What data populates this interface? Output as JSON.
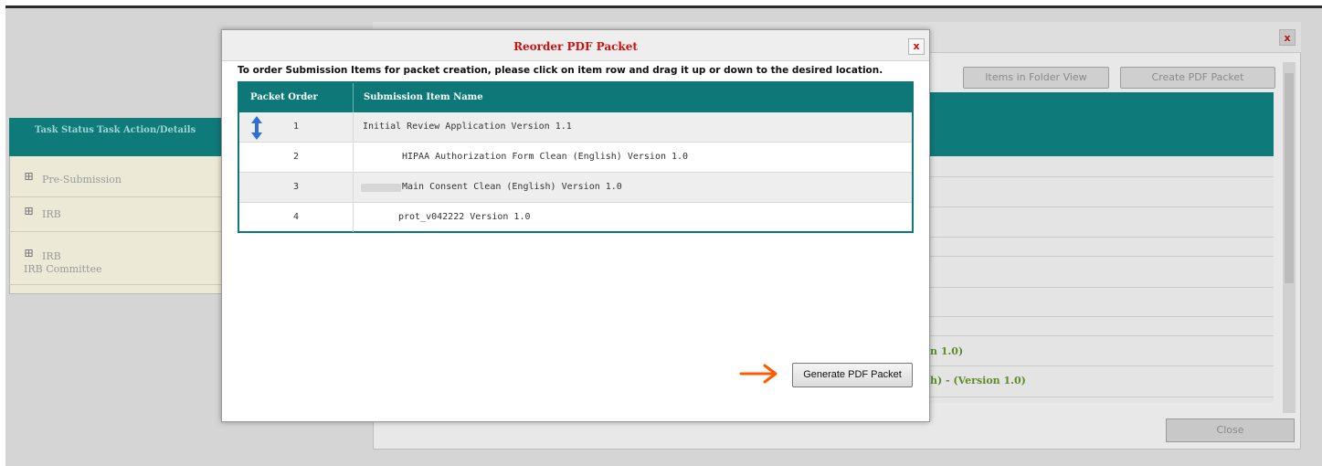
{
  "modal": {
    "title": "Reorder PDF Packet",
    "close_label": "x",
    "instruction": "To order Submission Items for packet creation, please click on item row and drag it up or down to the desired location.",
    "columns": [
      "Packet Order",
      "Submission Item Name"
    ],
    "rows": [
      {
        "order": "1",
        "name": "Initial Review Application Version 1.1"
      },
      {
        "order": "2",
        "name": "HIPAA Authorization Form Clean (English) Version 1.0"
      },
      {
        "order": "3",
        "name": "Main Consent Clean (English) Version 1.0"
      },
      {
        "order": "4",
        "name": "prot_v042222 Version 1.0"
      }
    ],
    "generate_button": "Generate PDF Packet",
    "drag_icon": "up-down-arrow-icon",
    "pointer_icon": "right-arrow-icon"
  },
  "background": {
    "dialog_close": "x",
    "folder_view_button": "Items in Folder View",
    "create_pdf_button": "Create PDF Packet",
    "close_button": "Close",
    "left_headers": [
      "Task Status",
      "Task Action/Details"
    ],
    "left_rows": [
      {
        "label": "Pre-Submission",
        "sub": ""
      },
      {
        "label": "IRB",
        "sub": ""
      },
      {
        "label": "IRB",
        "sub": "IRB Committee"
      }
    ],
    "right_fragments": [
      "n 1.0)",
      "h) - (Version 1.0)"
    ]
  },
  "colors": {
    "teal": "#0e7777",
    "title_red": "#cc1111",
    "arrow_orange": "#ff5a00",
    "drag_blue": "#2f6fdc"
  }
}
